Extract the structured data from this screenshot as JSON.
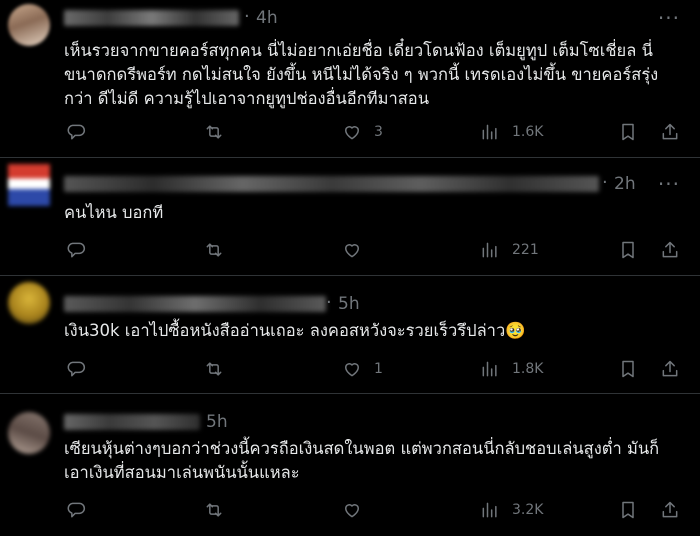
{
  "posts": [
    {
      "time": "4h",
      "text_lines": [
        "เห็นรวยจากขายคอร์สทุกคน นี่ไม่อยากเอ่ยชื่อ เดี๋ยวโดนฟ้อง เต็มยูทูป เต็มโซเชี่ยล นี่",
        "ขนาดกดรีพอร์ท กดไม่สนใจ ยังขึ้น หนีไม่ได้จริง ๆ พวกนี้ เทรดเองไม่ขึ้น ขายคอร์สรุ่ง",
        "กว่า ดีไม่ดี ความรู้ไปเอาจากยูทูปช่องอื่นอีกทีมาสอน"
      ],
      "likes": "3",
      "views": "1.6K"
    },
    {
      "time": "2h",
      "text_lines": [
        "คนไหน บอกที"
      ],
      "likes": "",
      "views": "221"
    },
    {
      "time": "5h",
      "text_lines": [
        "เงิน30k เอาไปซื้อหนังสืออ่านเถอะ ลงคอสหวังจะรวยเร็วรึปล่าว🥹"
      ],
      "likes": "1",
      "views": "1.8K"
    },
    {
      "time": "5h",
      "text_lines": [
        "เซียนหุ้นต่างๆบอกว่าช่วงนี้ควรถือเงินสดในพอต แต่พวกสอนนี่กลับชอบเล่นสูงต่ำ มันก็",
        "เอาเงินที่สอนมาเล่นพนันนั้นแหละ"
      ],
      "likes": "",
      "views": "3.2K"
    }
  ],
  "icons": {
    "reply": "reply-icon",
    "repost": "repost-icon",
    "like": "heart-icon",
    "views": "views-icon",
    "bookmark": "bookmark-icon",
    "share": "share-icon",
    "more": "more-icon"
  },
  "more_glyph": "···",
  "dot": "·"
}
